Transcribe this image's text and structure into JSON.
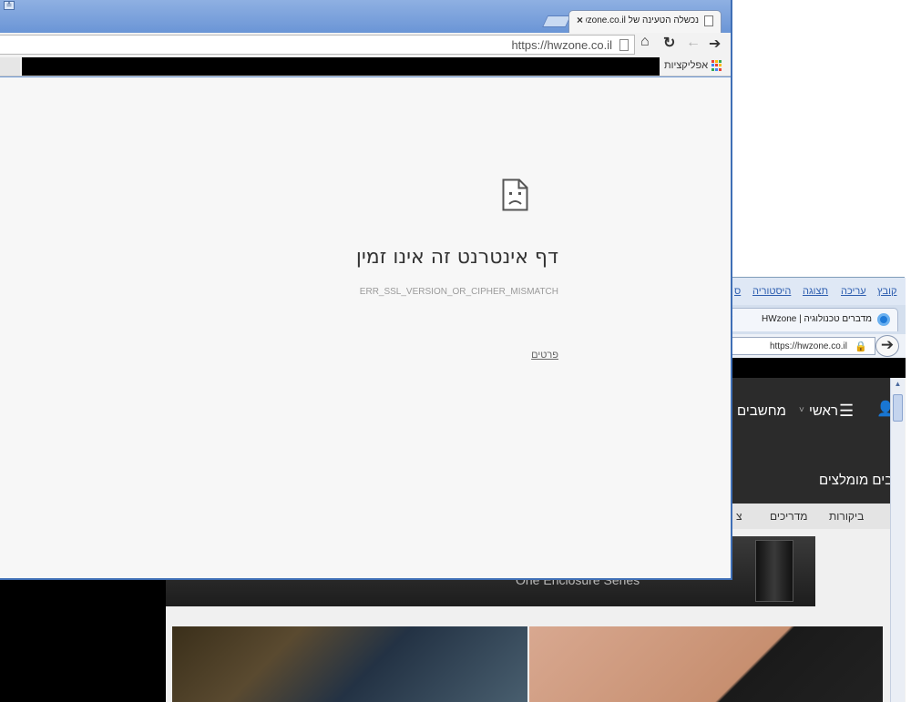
{
  "back_window": {
    "menu": [
      "קובץ",
      "עריכה",
      "תצוגה",
      "היסטוריה",
      "ס"
    ],
    "tab_title": "HWzone | מדברים טכנולוגיה",
    "tab_close": "×",
    "url": "https://hwzone.co.il",
    "forward_glyph": "➔",
    "site_nav": {
      "user_glyph": "👤",
      "menu_glyph": "☰",
      "home_label": "ראשי",
      "chevron": "˅",
      "computers_label": "מחשבים"
    },
    "recommended_label": "ובים מומלצים",
    "subnav": [
      "ביקורות",
      "מדריכים",
      "צ"
    ],
    "banner_text": "One Enclosure Series",
    "scroll_up": "▲"
  },
  "front_window": {
    "user_glyph": "≗",
    "tab_title": "נכשלה הטעינה של https://hwzone.co.il/",
    "tab_close": "×",
    "toolbar": {
      "forward": "➔",
      "back": "←",
      "reload": "↻",
      "home": "⌂"
    },
    "url": "https://hwzone.co.il",
    "apps_label": "אפליקציות",
    "apps_colors": [
      "#e94235",
      "#fbbc04",
      "#34a853",
      "#4285f4",
      "#e94235",
      "#fbbc04",
      "#34a853",
      "#4285f4",
      "#e94235"
    ],
    "error": {
      "title": "דף אינטרנט זה אינו זמין",
      "code": "ERR_SSL_VERSION_OR_CIPHER_MISMATCH",
      "details_link": "פרטים"
    }
  }
}
